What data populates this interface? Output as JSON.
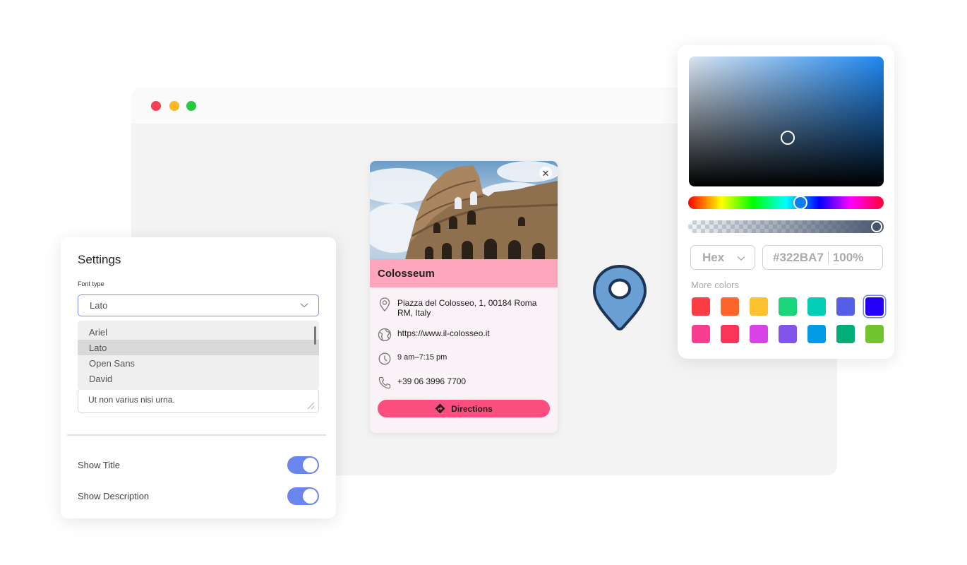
{
  "browser": {
    "window_controls": [
      "close",
      "minimize",
      "maximize"
    ]
  },
  "card": {
    "title": "Colosseum",
    "close_icon": "close-icon",
    "address": "Piazza del Colosseo, 1, 00184 Roma RM, Italy",
    "website": "https://www.il-colosseo.it",
    "hours": "9 am–7:15 pm",
    "phone": "+39 06 3996 7700",
    "directions_label": "Directions",
    "colors": {
      "title_bar": "#fda5bc",
      "button": "#fb4d7e",
      "background": "#f9f2f6"
    }
  },
  "map_pin": {
    "icon": "map-pin-icon",
    "fill": "#6a9fd4",
    "stroke": "#1c3557"
  },
  "settings": {
    "title": "Settings",
    "font_type_label": "Font type",
    "font_selected": "Lato",
    "font_options": [
      "Ariel",
      "Lato",
      "Open Sans",
      "David"
    ],
    "description_text": "Ut non varius nisi urna.",
    "toggles": [
      {
        "label": "Show Title",
        "on": true
      },
      {
        "label": "Show Description",
        "on": true
      }
    ],
    "accent": "#6a85ee"
  },
  "color_picker": {
    "format": "Hex",
    "hex_value": "#322BA7",
    "opacity": "100%",
    "more_colors_label": "More colors",
    "swatches": [
      [
        "#fc3d46",
        "#fd662b",
        "#fdc02e",
        "#1ad57a",
        "#04cdb5",
        "#545ee8",
        "#2400f8"
      ],
      [
        "#f6408f",
        "#fa3559",
        "#d843e8",
        "#8155ec",
        "#039be6",
        "#02ad78",
        "#72c42d"
      ]
    ],
    "selected_swatch": "#2400f8"
  }
}
